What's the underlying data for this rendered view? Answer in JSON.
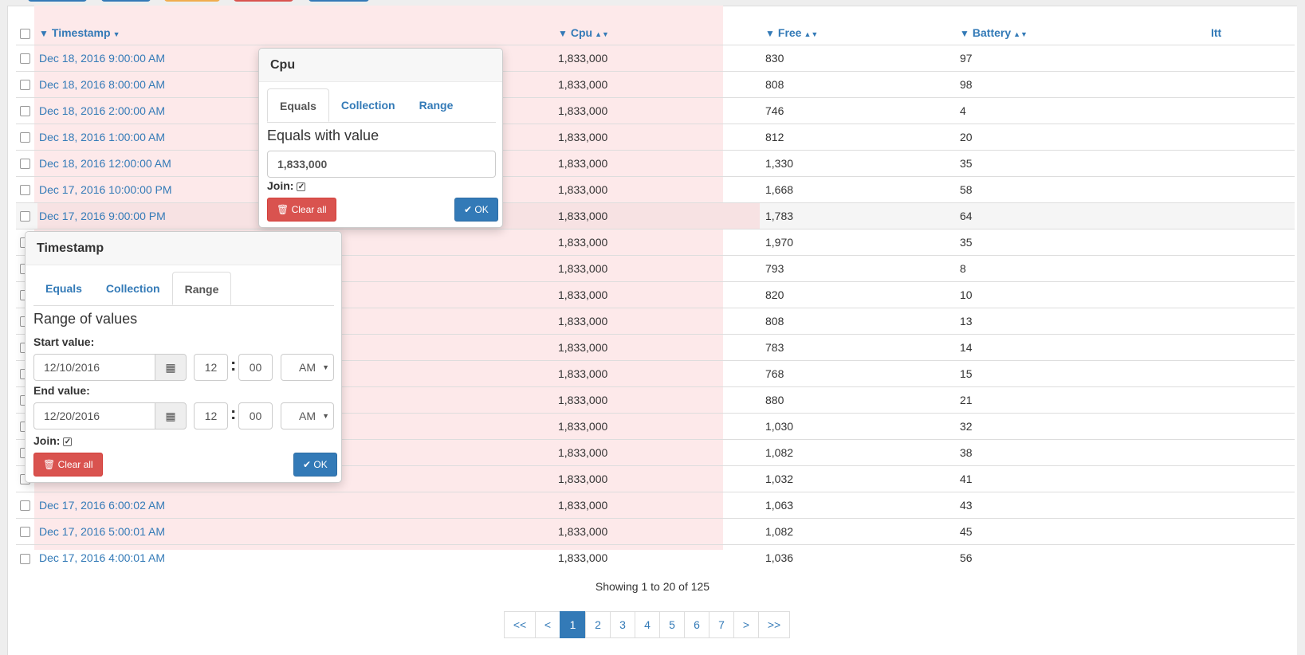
{
  "table": {
    "headers": {
      "timestamp": "Timestamp",
      "cpu": "Cpu",
      "free": "Free",
      "battery": "Battery",
      "itt": "Itt"
    },
    "rows": [
      {
        "timestamp": "Dec 18, 2016 9:00:00 AM",
        "cpu": "1,833,000",
        "free": "830",
        "battery": "97"
      },
      {
        "timestamp": "Dec 18, 2016 8:00:00 AM",
        "cpu": "1,833,000",
        "free": "808",
        "battery": "98"
      },
      {
        "timestamp": "Dec 18, 2016 2:00:00 AM",
        "cpu": "1,833,000",
        "free": "746",
        "battery": "4"
      },
      {
        "timestamp": "Dec 18, 2016 1:00:00 AM",
        "cpu": "1,833,000",
        "free": "812",
        "battery": "20"
      },
      {
        "timestamp": "Dec 18, 2016 12:00:00 AM",
        "cpu": "1,833,000",
        "free": "1,330",
        "battery": "35"
      },
      {
        "timestamp": "Dec 17, 2016 10:00:00 PM",
        "cpu": "1,833,000",
        "free": "1,668",
        "battery": "58"
      },
      {
        "timestamp": "Dec 17, 2016 9:00:00 PM",
        "cpu": "1,833,000",
        "free": "1,783",
        "battery": "64"
      },
      {
        "timestamp": "",
        "cpu": "1,833,000",
        "free": "1,970",
        "battery": "35"
      },
      {
        "timestamp": "",
        "cpu": "1,833,000",
        "free": "793",
        "battery": "8"
      },
      {
        "timestamp": "",
        "cpu": "1,833,000",
        "free": "820",
        "battery": "10"
      },
      {
        "timestamp": "",
        "cpu": "1,833,000",
        "free": "808",
        "battery": "13"
      },
      {
        "timestamp": "",
        "cpu": "1,833,000",
        "free": "783",
        "battery": "14"
      },
      {
        "timestamp": "",
        "cpu": "1,833,000",
        "free": "768",
        "battery": "15"
      },
      {
        "timestamp": "",
        "cpu": "1,833,000",
        "free": "880",
        "battery": "21"
      },
      {
        "timestamp": "",
        "cpu": "1,833,000",
        "free": "1,030",
        "battery": "32"
      },
      {
        "timestamp": "",
        "cpu": "1,833,000",
        "free": "1,082",
        "battery": "38"
      },
      {
        "timestamp": "",
        "cpu": "1,833,000",
        "free": "1,032",
        "battery": "41"
      },
      {
        "timestamp": "Dec 17, 2016 6:00:02 AM",
        "cpu": "1,833,000",
        "free": "1,063",
        "battery": "43"
      },
      {
        "timestamp": "Dec 17, 2016 5:00:01 AM",
        "cpu": "1,833,000",
        "free": "1,082",
        "battery": "45"
      },
      {
        "timestamp": "Dec 17, 2016 4:00:01 AM",
        "cpu": "1,833,000",
        "free": "1,036",
        "battery": "56"
      }
    ]
  },
  "footer": {
    "showing": "Showing 1 to 20 of 125"
  },
  "pagination": {
    "items": [
      "<<",
      "<",
      "1",
      "2",
      "3",
      "4",
      "5",
      "6",
      "7",
      ">",
      ">>"
    ],
    "active": "1"
  },
  "cpu_popover": {
    "title": "Cpu",
    "tabs": [
      "Equals",
      "Collection",
      "Range"
    ],
    "active_tab": "Equals",
    "subtitle": "Equals with value",
    "value": "1,833,000",
    "join_label": "Join:",
    "clear_label": "Clear all",
    "ok_label": "OK"
  },
  "timestamp_popover": {
    "title": "Timestamp",
    "tabs": [
      "Equals",
      "Collection",
      "Range"
    ],
    "active_tab": "Range",
    "subtitle": "Range of values",
    "start_label": "Start value:",
    "start_date": "12/10/2016",
    "start_hour": "12",
    "start_minute": "00",
    "start_ampm": "AM",
    "end_label": "End value:",
    "end_date": "12/20/2016",
    "end_hour": "12",
    "end_minute": "00",
    "end_ampm": "AM",
    "join_label": "Join:",
    "clear_label": "Clear all",
    "ok_label": "OK"
  },
  "colors": {
    "accent": "#337ab7",
    "danger": "#d9534f",
    "column_highlight": "#fde9ea"
  },
  "icons": {
    "filter": "filter-icon",
    "sort": "sort-icon",
    "calendar": "calendar-icon",
    "trash": "trash-icon",
    "check": "check-icon"
  }
}
